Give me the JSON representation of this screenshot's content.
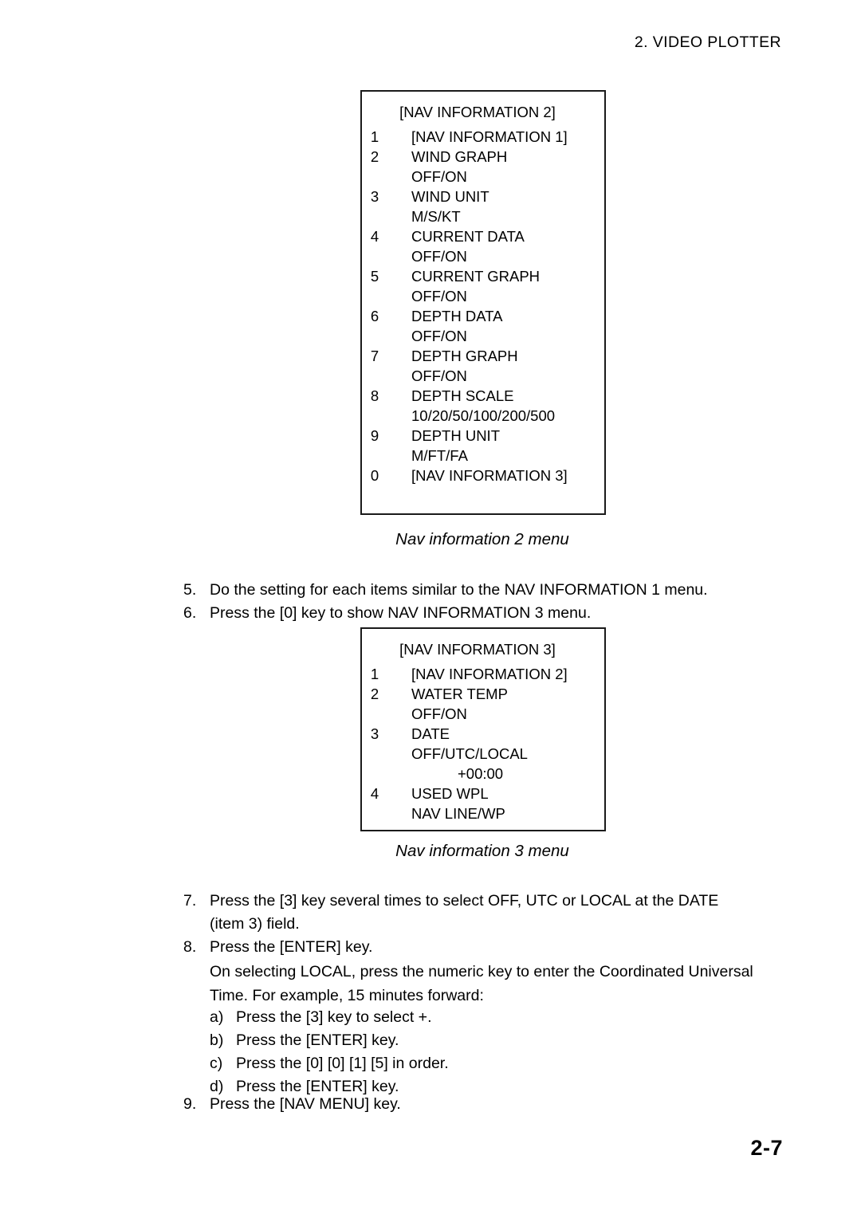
{
  "header": {
    "chapter_title": "2. VIDEO PLOTTER"
  },
  "footer": {
    "page_number": "2-7"
  },
  "menu_2": {
    "title": "[NAV INFORMATION 2]",
    "rows": [
      {
        "num": "1",
        "label": "[NAV INFORMATION 1]",
        "kind": "item"
      },
      {
        "num": "2",
        "label": "WIND GRAPH",
        "kind": "item"
      },
      {
        "num": "",
        "label": "OFF/ON",
        "kind": "sub"
      },
      {
        "num": "3",
        "label": "WIND UNIT",
        "kind": "item"
      },
      {
        "num": "",
        "label": "M/S/KT",
        "kind": "sub"
      },
      {
        "num": "4",
        "label": "CURRENT DATA",
        "kind": "item"
      },
      {
        "num": "",
        "label": "OFF/ON",
        "kind": "sub"
      },
      {
        "num": "5",
        "label": "CURRENT GRAPH",
        "kind": "item"
      },
      {
        "num": "",
        "label": "OFF/ON",
        "kind": "sub"
      },
      {
        "num": "6",
        "label": "DEPTH DATA",
        "kind": "item"
      },
      {
        "num": "",
        "label": "OFF/ON",
        "kind": "sub"
      },
      {
        "num": "7",
        "label": "DEPTH GRAPH",
        "kind": "item"
      },
      {
        "num": "",
        "label": "OFF/ON",
        "kind": "sub"
      },
      {
        "num": "8",
        "label": "DEPTH SCALE",
        "kind": "item"
      },
      {
        "num": "",
        "label": "10/20/50/100/200/500",
        "kind": "sub"
      },
      {
        "num": "9",
        "label": "DEPTH UNIT",
        "kind": "item"
      },
      {
        "num": "",
        "label": "M/FT/FA",
        "kind": "sub"
      },
      {
        "num": "0",
        "label": "[NAV INFORMATION 3]",
        "kind": "item"
      }
    ],
    "caption": "Nav information 2 menu"
  },
  "menu_3": {
    "title": "[NAV INFORMATION 3]",
    "rows": [
      {
        "num": "1",
        "label": "[NAV INFORMATION 2]",
        "kind": "item"
      },
      {
        "num": "2",
        "label": "WATER TEMP",
        "kind": "item"
      },
      {
        "num": "",
        "label": "OFF/ON",
        "kind": "sub"
      },
      {
        "num": "3",
        "label": "DATE",
        "kind": "item"
      },
      {
        "num": "",
        "label": "OFF/UTC/LOCAL",
        "kind": "sub"
      },
      {
        "num": "",
        "label": "+00:00",
        "kind": "sub2"
      },
      {
        "num": "4",
        "label": "USED WPL",
        "kind": "item"
      },
      {
        "num": "",
        "label": "NAV LINE/WP",
        "kind": "sub"
      }
    ],
    "caption": "Nav information 3 menu"
  },
  "steps": {
    "step_5": {
      "num": "5.",
      "text": "Do the setting for each items similar to the NAV INFORMATION 1 menu."
    },
    "step_6": {
      "num": "6.",
      "text": "Press the [0] key to show NAV INFORMATION 3 menu."
    },
    "step_7": {
      "num": "7.",
      "text": "Press the [3] key several times to select OFF, UTC or LOCAL at the DATE\n(item 3) field."
    },
    "step_8": {
      "num": "8.",
      "text": "Press the [ENTER] key."
    },
    "step_9": {
      "num": "9.",
      "text": "Press the [NAV MENU] key."
    }
  },
  "sub_paragraph": "On selecting LOCAL, press the numeric key to enter the Coordinated Universal Time. For example, 15 minutes forward:",
  "substeps": [
    {
      "letter": "a)",
      "text": "Press the [3] key to select +."
    },
    {
      "letter": "b)",
      "text": "Press the [ENTER] key."
    },
    {
      "letter": "c)",
      "text": "Press the [0] [0] [1] [5] in order."
    },
    {
      "letter": "d)",
      "text": "Press the [ENTER] key."
    }
  ],
  "colors": {
    "page_background": "#ffffff",
    "text": "#000000",
    "box_border": "#1a1a1a"
  }
}
